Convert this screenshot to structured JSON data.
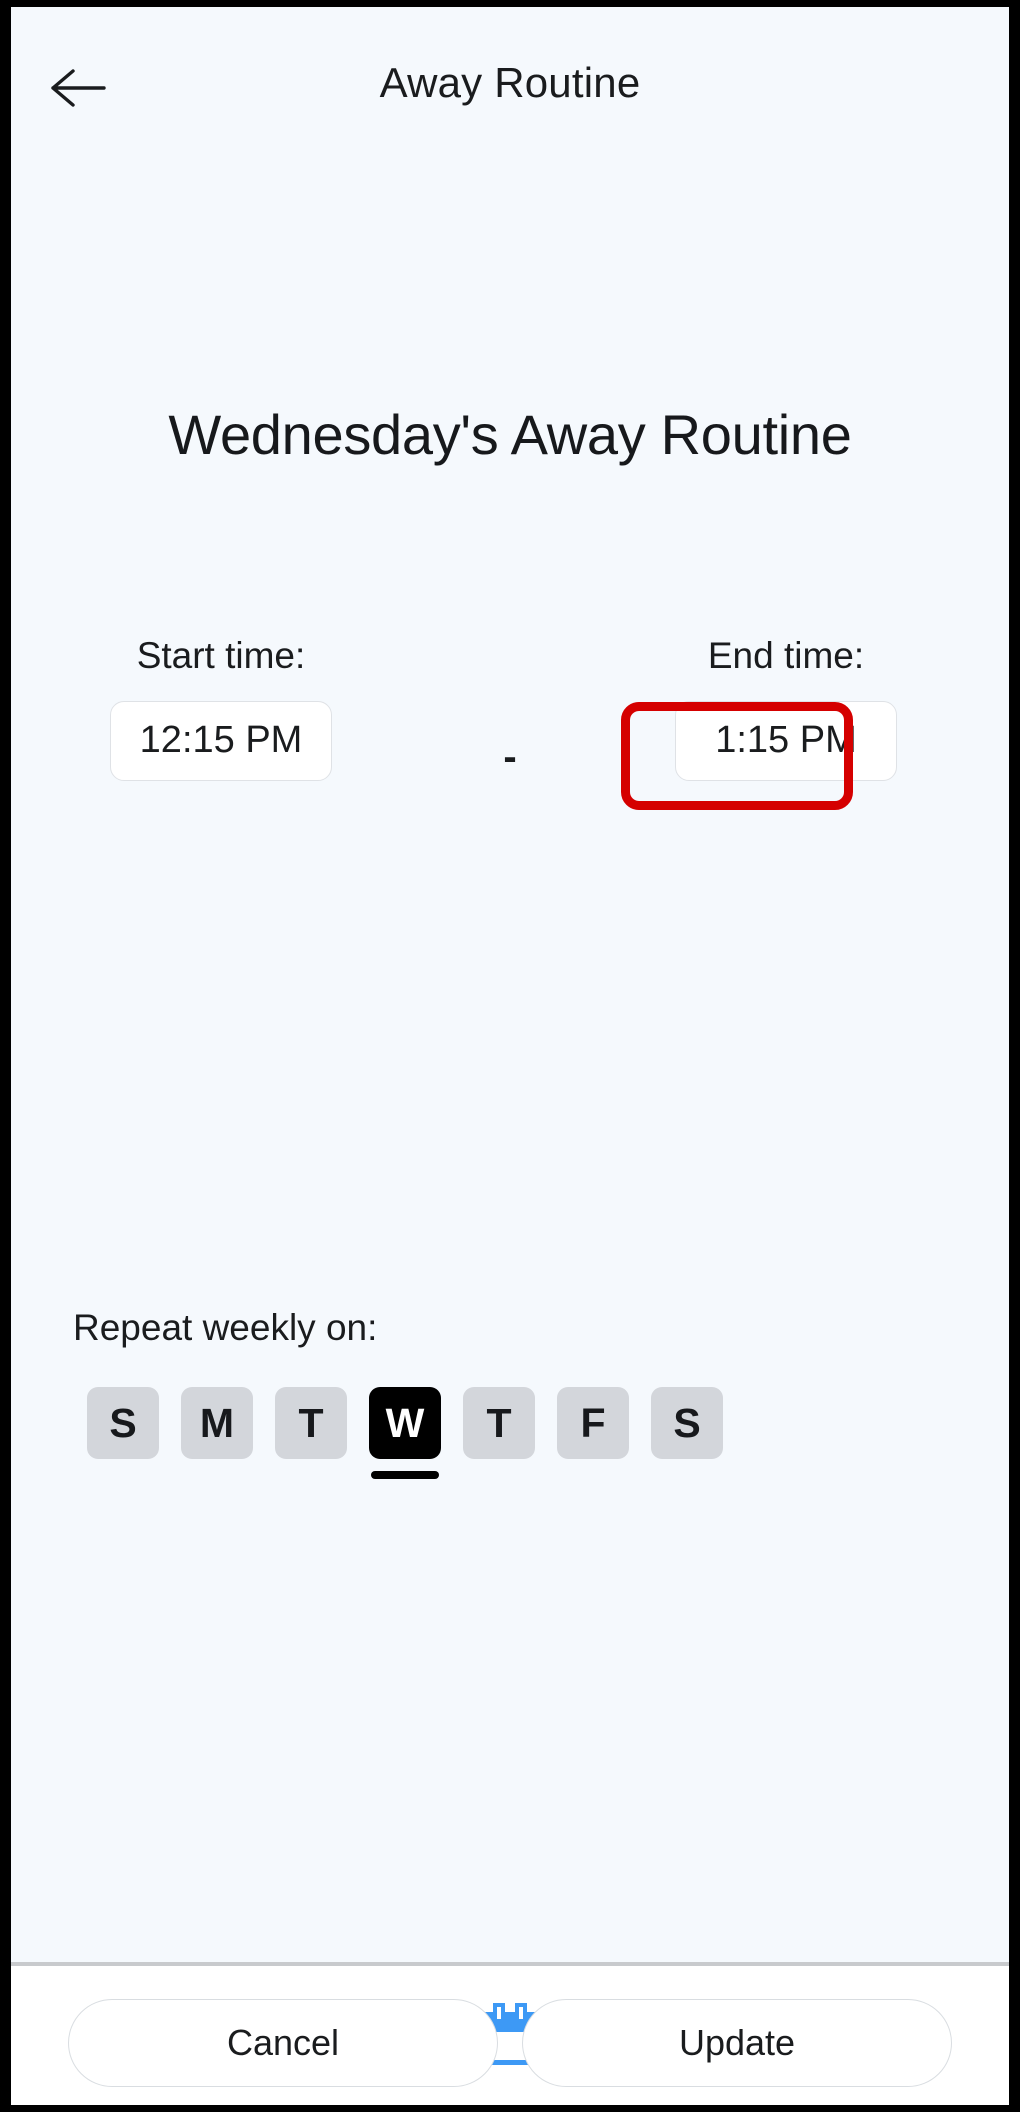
{
  "app_bar": {
    "back_icon": "arrow-left-icon",
    "title": "Away Routine"
  },
  "main": {
    "heading": "Wednesday's Away Routine",
    "start": {
      "label": "Start time:",
      "value": "12:15 PM"
    },
    "separator": "-",
    "end": {
      "label": "End time:",
      "value": "1:15 PM"
    },
    "highlight_color": "#d50000",
    "repeat": {
      "label": "Repeat weekly on:",
      "days": [
        {
          "letter": "S",
          "name": "Sunday",
          "selected": false
        },
        {
          "letter": "M",
          "name": "Monday",
          "selected": false
        },
        {
          "letter": "T",
          "name": "Tuesday",
          "selected": false
        },
        {
          "letter": "W",
          "name": "Wednesday",
          "selected": true
        },
        {
          "letter": "T",
          "name": "Thursday",
          "selected": false
        },
        {
          "letter": "F",
          "name": "Friday",
          "selected": false
        },
        {
          "letter": "S",
          "name": "Saturday",
          "selected": false
        }
      ]
    },
    "actions": {
      "cancel_label": "Cancel",
      "update_label": "Update"
    }
  },
  "bottom_nav": {
    "active_color": "#3d99f5",
    "items": [
      {
        "icon": "thermometer-icon",
        "active": false
      },
      {
        "icon": "sliders-icon",
        "active": false
      },
      {
        "icon": "calendar-icon",
        "active": true
      },
      {
        "icon": "bar-chart-icon",
        "active": false
      },
      {
        "icon": "more-vertical-icon",
        "active": false
      }
    ]
  }
}
